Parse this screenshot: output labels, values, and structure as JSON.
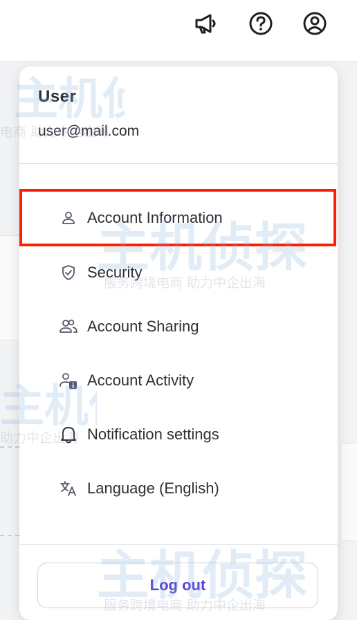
{
  "header": {
    "icons": [
      "megaphone-icon",
      "help-icon",
      "account-icon"
    ]
  },
  "menu": {
    "user_name": "User",
    "user_email": "user@mail.com",
    "items": [
      {
        "label": "Account Information",
        "icon": "person-icon"
      },
      {
        "label": "Security",
        "icon": "shield-icon"
      },
      {
        "label": "Account Sharing",
        "icon": "people-icon"
      },
      {
        "label": "Account Activity",
        "icon": "person-info-icon"
      },
      {
        "label": "Notification settings",
        "icon": "bell-icon"
      },
      {
        "label": "Language (English)",
        "icon": "translate-icon"
      }
    ],
    "logout_label": "Log out",
    "selected_item": "Account Information"
  },
  "colors": {
    "accent": "#5b3fd9",
    "highlight": "#ff1e00",
    "text": "#2d2f36"
  },
  "watermark": {
    "main": "主机侦探",
    "sub1": "服务跨境电商 助力中企出海",
    "sub2": "电商 助力中企出海",
    "sub3": "助力中企出海"
  }
}
